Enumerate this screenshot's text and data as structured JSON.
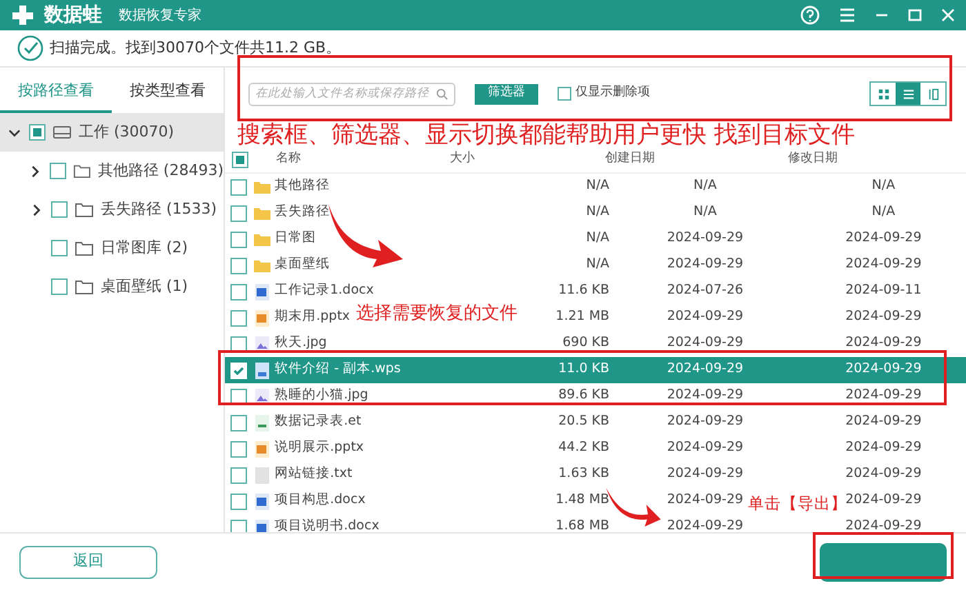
{
  "window": {
    "app_name": "数据蛙",
    "subtitle": "数据恢复专家"
  },
  "scan_status": "扫描完成。找到30070个文件共11.2 GB。",
  "view_tabs": [
    {
      "label": "按路径查看",
      "selected": true
    },
    {
      "label": "按类型查看",
      "selected": false
    }
  ],
  "tree": [
    {
      "label": "工作 (30070)",
      "checked": false,
      "partial": true,
      "expanded": true,
      "selected": true,
      "kind": "drive",
      "children": [
        {
          "label": "其他路径 (28493)",
          "checked": false,
          "partial": false,
          "expanded": false,
          "selected": false,
          "kind": "folder"
        },
        {
          "label": "丢失路径 (1533)",
          "checked": false,
          "partial": false,
          "expanded": false,
          "selected": false,
          "kind": "folder"
        },
        {
          "label": "日常图库 (2)",
          "checked": false,
          "partial": false,
          "selected": false,
          "kind": "folder"
        },
        {
          "label": "桌面壁纸 (1)",
          "checked": false,
          "partial": false,
          "selected": false,
          "kind": "folder"
        }
      ]
    }
  ],
  "toolbar": {
    "search": {
      "placeholder": "在此处输入文件名称或保存路径"
    },
    "filter_button": "筛选器",
    "deleted_only": {
      "label": "仅显示删除项",
      "checked": false
    },
    "view_modes": [
      {
        "kind": "grid",
        "selected": false
      },
      {
        "kind": "list",
        "selected": true
      },
      {
        "kind": "columns",
        "selected": false
      }
    ]
  },
  "table": {
    "select_all": {
      "partial": true
    },
    "columns": [
      "名称",
      "大小",
      "创建日期",
      "修改日期"
    ],
    "rows": [
      {
        "kind": "folder",
        "name": "其他路径",
        "size": "N/A",
        "created": "N/A",
        "modified": "N/A",
        "checked": false,
        "selected": false
      },
      {
        "kind": "folder",
        "name": "丢失路径",
        "size": "N/A",
        "created": "N/A",
        "modified": "N/A",
        "checked": false,
        "selected": false
      },
      {
        "kind": "folder",
        "name": "日常图",
        "size": "N/A",
        "created": "2024-09-29",
        "modified": "2024-09-29",
        "checked": false,
        "selected": false
      },
      {
        "kind": "folder",
        "name": "桌面壁纸",
        "size": "N/A",
        "created": "2024-09-29",
        "modified": "2024-09-29",
        "checked": false,
        "selected": false
      },
      {
        "kind": "word",
        "name": "工作记录1.docx",
        "size": "11.6 KB",
        "created": "2024-07-26",
        "modified": "2024-09-11",
        "checked": false,
        "selected": false
      },
      {
        "kind": "slides",
        "name": "期末用.pptx",
        "size": "1.21 MB",
        "created": "2024-09-29",
        "modified": "2024-09-29",
        "checked": false,
        "selected": false
      },
      {
        "kind": "image",
        "name": "秋天.jpg",
        "size": "690 KB",
        "created": "2024-09-29",
        "modified": "2024-09-29",
        "checked": false,
        "selected": false
      },
      {
        "kind": "doc",
        "name": "软件介绍 - 副本.wps",
        "size": "11.0 KB",
        "created": "2024-09-29",
        "modified": "2024-09-29",
        "checked": true,
        "selected": true
      },
      {
        "kind": "image",
        "name": "熟睡的小猫.jpg",
        "size": "89.6 KB",
        "created": "2024-09-29",
        "modified": "2024-09-29",
        "checked": false,
        "selected": false
      },
      {
        "kind": "sheet",
        "name": "数据记录表.et",
        "size": "20.5 KB",
        "created": "2024-09-29",
        "modified": "2024-09-29",
        "checked": false,
        "selected": false
      },
      {
        "kind": "slides",
        "name": "说明展示.pptx",
        "size": "44.2 KB",
        "created": "2024-09-29",
        "modified": "2024-09-29",
        "checked": false,
        "selected": false
      },
      {
        "kind": "text",
        "name": "网站链接.txt",
        "size": "1.63 KB",
        "created": "2024-09-29",
        "modified": "2024-09-29",
        "checked": false,
        "selected": false
      },
      {
        "kind": "word",
        "name": "项目构思.docx",
        "size": "1.48 MB",
        "created": "2024-09-29",
        "modified": "2024-09-29",
        "checked": false,
        "selected": false
      },
      {
        "kind": "word",
        "name": "项目说明书.docx",
        "size": "1.68 MB",
        "created": "2024-09-29",
        "modified": "2024-09-29",
        "checked": false,
        "selected": false
      }
    ]
  },
  "back_button": "返回",
  "annotations": [
    "搜索框、筛选器、显示切换都能帮助用户更快 找到目标文件",
    "选择需要恢复的文件",
    "单击【导出】"
  ]
}
